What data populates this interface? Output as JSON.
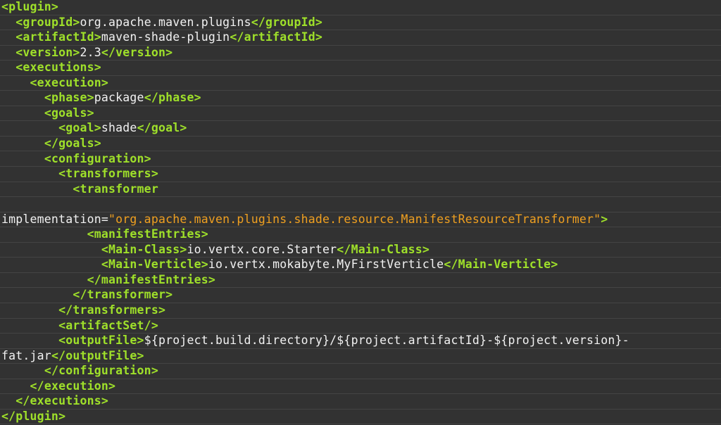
{
  "theme": {
    "background": "#323232",
    "tag_color": "#9fe02a",
    "text_color": "#f2f2f2",
    "string_color": "#f0a020",
    "separator_color": "#444444"
  },
  "lines": [
    [
      {
        "t": "tag",
        "v": "<plugin>"
      }
    ],
    [
      {
        "t": "text",
        "v": "  "
      },
      {
        "t": "tag",
        "v": "<groupId>"
      },
      {
        "t": "text",
        "v": "org.apache.maven.plugins"
      },
      {
        "t": "tag",
        "v": "</groupId>"
      }
    ],
    [
      {
        "t": "text",
        "v": "  "
      },
      {
        "t": "tag",
        "v": "<artifactId>"
      },
      {
        "t": "text",
        "v": "maven-shade-plugin"
      },
      {
        "t": "tag",
        "v": "</artifactId>"
      }
    ],
    [
      {
        "t": "text",
        "v": "  "
      },
      {
        "t": "tag",
        "v": "<version>"
      },
      {
        "t": "text",
        "v": "2.3"
      },
      {
        "t": "tag",
        "v": "</version>"
      }
    ],
    [
      {
        "t": "text",
        "v": "  "
      },
      {
        "t": "tag",
        "v": "<executions>"
      }
    ],
    [
      {
        "t": "text",
        "v": "    "
      },
      {
        "t": "tag",
        "v": "<execution>"
      }
    ],
    [
      {
        "t": "text",
        "v": "      "
      },
      {
        "t": "tag",
        "v": "<phase>"
      },
      {
        "t": "text",
        "v": "package"
      },
      {
        "t": "tag",
        "v": "</phase>"
      }
    ],
    [
      {
        "t": "text",
        "v": "      "
      },
      {
        "t": "tag",
        "v": "<goals>"
      }
    ],
    [
      {
        "t": "text",
        "v": "        "
      },
      {
        "t": "tag",
        "v": "<goal>"
      },
      {
        "t": "text",
        "v": "shade"
      },
      {
        "t": "tag",
        "v": "</goal>"
      }
    ],
    [
      {
        "t": "text",
        "v": "      "
      },
      {
        "t": "tag",
        "v": "</goals>"
      }
    ],
    [
      {
        "t": "text",
        "v": "      "
      },
      {
        "t": "tag",
        "v": "<configuration>"
      }
    ],
    [
      {
        "t": "text",
        "v": "        "
      },
      {
        "t": "tag",
        "v": "<transformers>"
      }
    ],
    [
      {
        "t": "text",
        "v": "          "
      },
      {
        "t": "tag",
        "v": "<transformer"
      }
    ],
    [],
    [
      {
        "t": "attr",
        "v": "implementation="
      },
      {
        "t": "str",
        "v": "\"org.apache.maven.plugins.shade.resource.ManifestResourceTransformer\""
      },
      {
        "t": "tag",
        "v": ">"
      }
    ],
    [
      {
        "t": "text",
        "v": "            "
      },
      {
        "t": "tag",
        "v": "<manifestEntries>"
      }
    ],
    [
      {
        "t": "text",
        "v": "              "
      },
      {
        "t": "tag",
        "v": "<Main-Class>"
      },
      {
        "t": "text",
        "v": "io.vertx.core.Starter"
      },
      {
        "t": "tag",
        "v": "</Main-Class>"
      }
    ],
    [
      {
        "t": "text",
        "v": "              "
      },
      {
        "t": "tag",
        "v": "<Main-Verticle>"
      },
      {
        "t": "text",
        "v": "io.vertx.mokabyte.MyFirstVerticle"
      },
      {
        "t": "tag",
        "v": "</Main-Verticle>"
      }
    ],
    [
      {
        "t": "text",
        "v": "            "
      },
      {
        "t": "tag",
        "v": "</manifestEntries>"
      }
    ],
    [
      {
        "t": "text",
        "v": "          "
      },
      {
        "t": "tag",
        "v": "</transformer>"
      }
    ],
    [
      {
        "t": "text",
        "v": "        "
      },
      {
        "t": "tag",
        "v": "</transformers>"
      }
    ],
    [
      {
        "t": "text",
        "v": "        "
      },
      {
        "t": "tag",
        "v": "<artifactSet/>"
      }
    ],
    [
      {
        "t": "text",
        "v": "        "
      },
      {
        "t": "tag",
        "v": "<outputFile>"
      },
      {
        "t": "text",
        "v": "${project.build.directory}/${project.artifactId}-${project.version}-"
      }
    ],
    [
      {
        "t": "text",
        "v": "fat.jar"
      },
      {
        "t": "tag",
        "v": "</outputFile>"
      }
    ],
    [
      {
        "t": "text",
        "v": "      "
      },
      {
        "t": "tag",
        "v": "</configuration>"
      }
    ],
    [
      {
        "t": "text",
        "v": "    "
      },
      {
        "t": "tag",
        "v": "</execution>"
      }
    ],
    [
      {
        "t": "text",
        "v": "  "
      },
      {
        "t": "tag",
        "v": "</executions>"
      }
    ],
    [
      {
        "t": "tag",
        "v": "</plugin>"
      }
    ]
  ]
}
